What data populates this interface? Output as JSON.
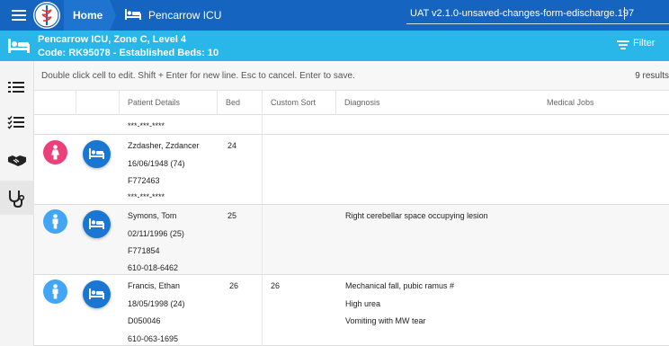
{
  "topbar": {
    "home_label": "Home",
    "ward_label": "Pencarrow ICU",
    "environment_value": "UAT v2.1.0-unsaved-changes-form-edischarge.197"
  },
  "ward": {
    "line1": "Pencarrow ICU, Zone C, Level 4",
    "line2": "Code: RK95078 - Established Beds: 10",
    "filter_label": "Filter"
  },
  "info": {
    "hint": "Double click cell to edit. Shift + Enter for new line. Esc to cancel. Enter to save.",
    "results": "9 results"
  },
  "table": {
    "columns": [
      "Patient Details",
      "Bed",
      "Custom Sort",
      "Diagnosis",
      "Medical Jobs"
    ],
    "partial_row": {
      "nhs": "***-***-****"
    },
    "rows": [
      {
        "gender": "female",
        "name": "Zzdasher, Zzdancer",
        "dob": "16/06/1948 (74)",
        "mrn": "F772463",
        "nhs": "***-***-****",
        "bed": "24",
        "custom_sort": "",
        "diagnosis": []
      },
      {
        "gender": "male",
        "name": "Symons, Tom",
        "dob": "02/11/1996 (25)",
        "mrn": "F771854",
        "nhs": "610-018-6462",
        "bed": "25",
        "custom_sort": "",
        "diagnosis": [
          "Right cerebellar space occupying lesion"
        ]
      },
      {
        "gender": "male",
        "name": "Francis, Ethan",
        "dob": "18/05/1998 (24)",
        "mrn": "D050046",
        "nhs": "610-063-1695",
        "bed": "26",
        "custom_sort": "26",
        "diagnosis": [
          "Mechanical fall, pubic ramus #",
          "High urea",
          "Vomiting with MW tear"
        ]
      }
    ]
  },
  "colors": {
    "topbar": "#1565c0",
    "wardbar": "#29b6e8",
    "female": "#ec407a",
    "male": "#42a5f5",
    "bed_button": "#1976d2"
  },
  "icons": {
    "menu": "hamburger-menu-icon",
    "logo": "caduceus-logo-icon",
    "bed": "bed-icon",
    "filter": "filter-icon",
    "nav": [
      "list-icon",
      "checklist-icon",
      "handshake-icon",
      "stethoscope-icon"
    ],
    "female": "female-person-icon",
    "male": "male-person-icon"
  }
}
